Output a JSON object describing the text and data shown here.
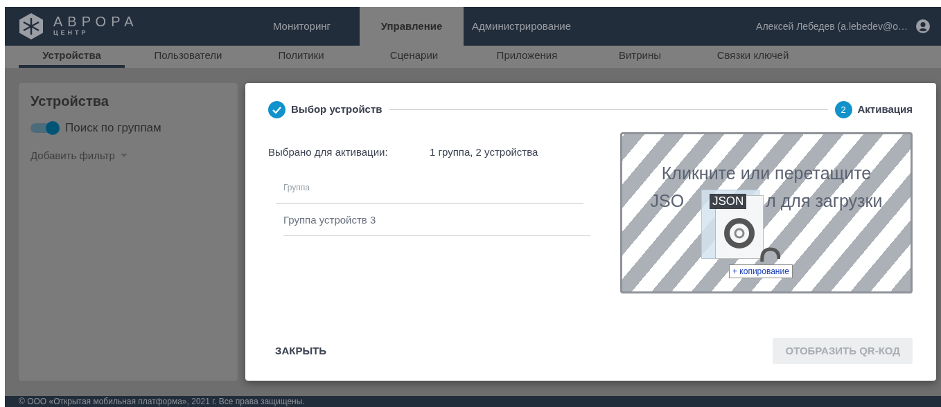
{
  "header": {
    "logo_title": "АВРОРА",
    "logo_subtitle": "ЦЕНТР",
    "nav": [
      {
        "label": "Мониторинг",
        "selected": false
      },
      {
        "label": "Управление",
        "selected": true
      },
      {
        "label": "Администрирование",
        "selected": false
      }
    ],
    "user": "Алексей Лебедев (a.lebedev@o…"
  },
  "subnav": [
    {
      "label": "Устройства",
      "selected": true
    },
    {
      "label": "Пользователи",
      "selected": false
    },
    {
      "label": "Политики",
      "selected": false
    },
    {
      "label": "Сценарии",
      "selected": false
    },
    {
      "label": "Приложения",
      "selected": false
    },
    {
      "label": "Витрины",
      "selected": false
    },
    {
      "label": "Связки ключей",
      "selected": false
    }
  ],
  "sidebar": {
    "title": "Устройства",
    "toggle": {
      "label": "Поиск по группам",
      "on": true
    },
    "add_filter": "Добавить фильтр"
  },
  "dialog": {
    "steps": [
      {
        "label": "Выбор устройств",
        "done": true
      },
      {
        "marker": "2",
        "label": "Активация",
        "done": false
      }
    ],
    "selected_label": "Выбрано для активации:",
    "selected_value": "1 группа, 2 устройства",
    "table": {
      "columns": [
        "Группа"
      ],
      "rows": [
        [
          "Группа устройств 3"
        ]
      ]
    },
    "dropzone": {
      "line_1": "Кликните или перетащите",
      "line_2_start": "JSO",
      "line_2_end": "л для загрузки",
      "drag_file_label": "JSON",
      "drag_tooltip_sign": "+",
      "drag_tooltip": "копирование"
    },
    "buttons": [
      {
        "label": "ЗАКРЫТЬ",
        "disabled": false
      },
      {
        "label": "ОТОБРАЗИТЬ QR-КОД",
        "disabled": true
      }
    ]
  },
  "footer": "© ООО «Открытая мобильная платформа», 2021 г. Все права защищены."
}
